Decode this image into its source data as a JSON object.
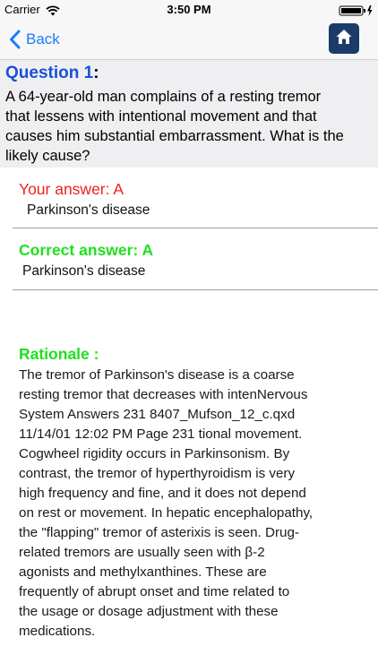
{
  "status_bar": {
    "carrier": "Carrier",
    "time": "3:50 PM",
    "wifi_icon": "wifi-icon",
    "battery_icon": "battery-charging-icon"
  },
  "nav": {
    "back_label": "Back",
    "back_icon": "chevron-left-icon",
    "home_icon": "home-icon",
    "accent_color": "#1e7cf6",
    "home_button_color": "#1b3c6b"
  },
  "question": {
    "label": "Question 1",
    "colon": ":",
    "lines": [
      "  A 64-year-old man complains of a resting tremor",
      "that lessens with intentional movement and that",
      "causes him substantial embarrassment. What is the",
      "likely cause?"
    ],
    "label_color": "#1a4fd8",
    "background_color": "#efeff2"
  },
  "your_answer": {
    "label": "Your answer: A",
    "value": "Parkinson's disease",
    "color": "#ef2020"
  },
  "correct_answer": {
    "label": "Correct answer: A",
    "value": "Parkinson's disease",
    "color": "#1fe01f"
  },
  "rationale": {
    "label": "Rationale :",
    "color": "#1fe01f",
    "lines": [
      " The tremor of Parkinson's disease is a coarse",
      "resting tremor that decreases with intenNervous",
      "System Answers 231 8407_Mufson_12_c.qxd",
      "11/14/01 12:02 PM Page 231 tional movement.",
      "Cogwheel rigidity occurs in Parkinsonism. By",
      "contrast, the tremor of hyperthyroidism is very",
      "high frequency and fine, and it does not depend",
      "on rest or movement. In hepatic encephalopathy,",
      "the \"flapping\" tremor of asterixis is seen. Drug-",
      "related tremors are usually seen with β-2",
      "agonists and methylxanthines. These are",
      "frequently of abrupt onset and time related to",
      "the usage or dosage adjustment with these",
      "medications."
    ]
  }
}
